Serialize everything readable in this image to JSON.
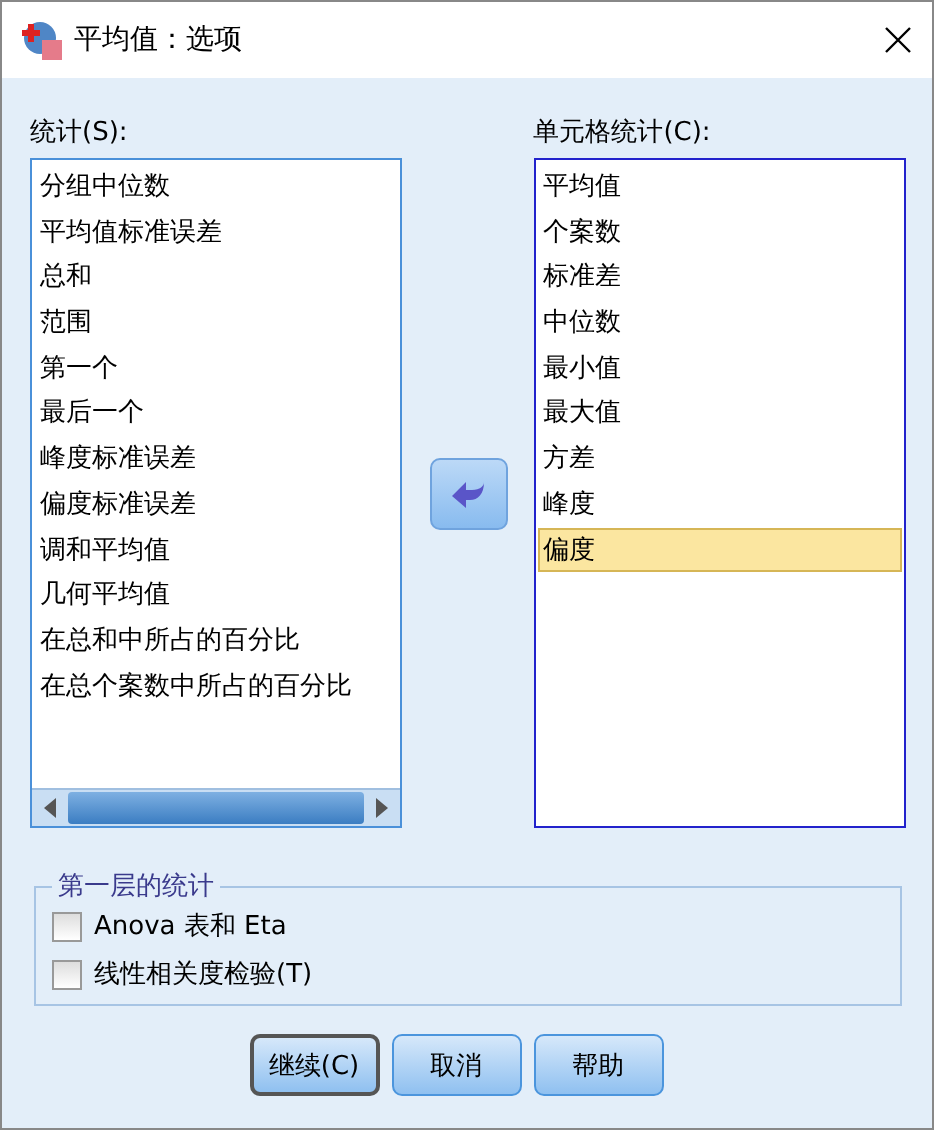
{
  "window": {
    "title": "平均值：选项"
  },
  "statistics": {
    "label": "统计(S):",
    "items": [
      {
        "label": "分组中位数",
        "selected": false
      },
      {
        "label": "平均值标准误差",
        "selected": false
      },
      {
        "label": "总和",
        "selected": false
      },
      {
        "label": "范围",
        "selected": false
      },
      {
        "label": "第一个",
        "selected": false
      },
      {
        "label": "最后一个",
        "selected": false
      },
      {
        "label": "峰度标准误差",
        "selected": false
      },
      {
        "label": "偏度标准误差",
        "selected": false
      },
      {
        "label": "调和平均值",
        "selected": false
      },
      {
        "label": "几何平均值",
        "selected": false
      },
      {
        "label": "在总和中所占的百分比",
        "selected": false
      },
      {
        "label": "在总个案数中所占的百分比",
        "selected": false
      }
    ]
  },
  "cell_statistics": {
    "label": "单元格统计(C):",
    "items": [
      {
        "label": "平均值",
        "selected": false
      },
      {
        "label": "个案数",
        "selected": false
      },
      {
        "label": "标准差",
        "selected": false
      },
      {
        "label": "中位数",
        "selected": false
      },
      {
        "label": "最小值",
        "selected": false
      },
      {
        "label": "最大值",
        "selected": false
      },
      {
        "label": "方差",
        "selected": false
      },
      {
        "label": "峰度",
        "selected": false
      },
      {
        "label": "偏度",
        "selected": true
      }
    ]
  },
  "first_layer": {
    "title": "第一层的统计",
    "options": [
      {
        "label": "Anova 表和 Eta",
        "checked": false
      },
      {
        "label": "线性相关度检验(T)",
        "checked": false
      }
    ]
  },
  "buttons": [
    {
      "label": "继续(C)",
      "default": true
    },
    {
      "label": "取消",
      "default": false
    },
    {
      "label": "帮助",
      "default": false
    }
  ]
}
